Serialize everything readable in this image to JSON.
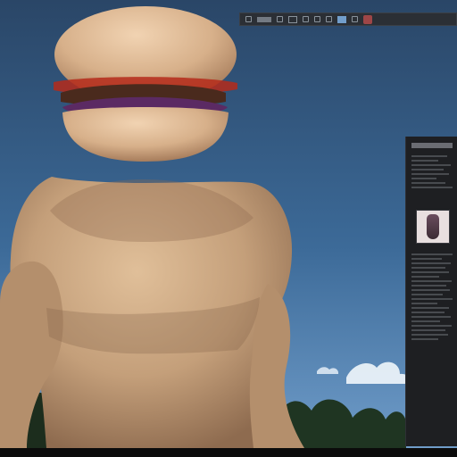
{
  "colors": {
    "sky_top": "#2a4667",
    "sky_mid": "#3c6a98",
    "sky_bottom": "#6f9cc9",
    "character_skin": "#c49f7a",
    "bun": "#d7b08a",
    "patty": "#4a2a1d",
    "lettuce_purple": "#5b2a63",
    "tomato_red": "#b52a1a",
    "ui_dark": "#1e1f22",
    "ui_border": "#2f3035"
  },
  "toolbar": {
    "icons": [
      "layers-icon",
      "move-icon",
      "select-icon",
      "camera-icon",
      "brush-icon",
      "eraser-icon",
      "grid-icon",
      "image-icon",
      "export-icon",
      "close-icon"
    ]
  },
  "side_panel": {
    "thumbnail_icon": "image-thumbnail-icon"
  }
}
